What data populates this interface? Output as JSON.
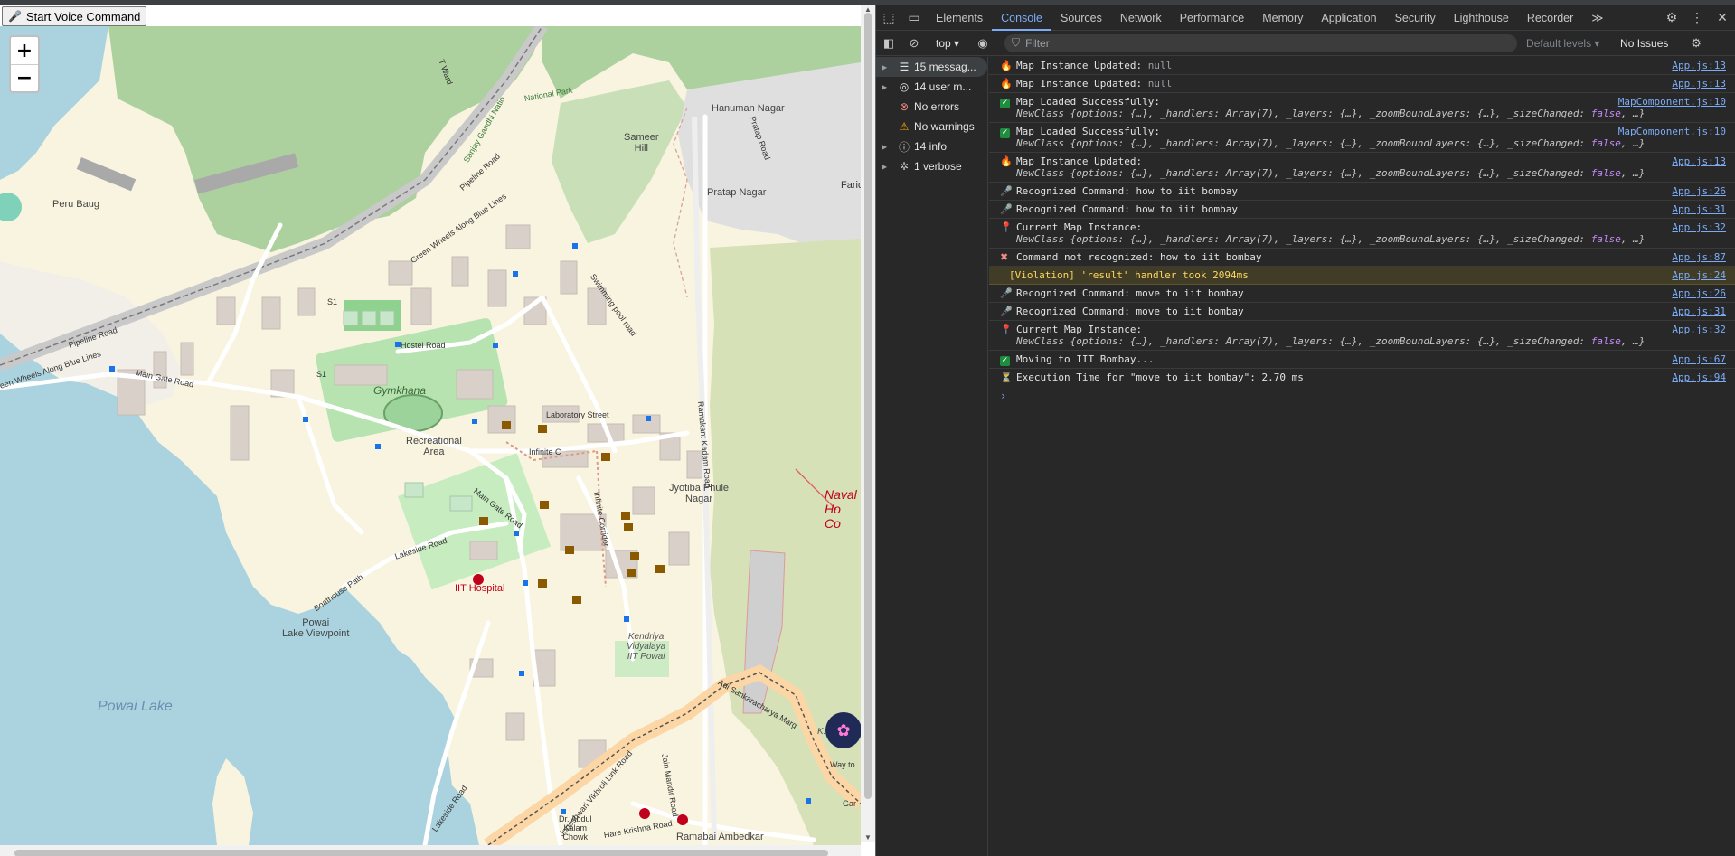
{
  "page": {
    "voice_button_label": "Start Voice Command",
    "voice_button_icon": "microphone-icon"
  },
  "map": {
    "zoom_in": "+",
    "zoom_out": "−",
    "labels": {
      "peru_baug": "Peru Baug",
      "hanuman_nagar": "Hanuman Nagar",
      "pratap_nagar": "Pratap Nagar",
      "sameer_hill": "Sameer\nHill",
      "gymkhana": "Gymkhana",
      "recreational_area": "Recreational\nArea",
      "laboratory_street": "Laboratory Street",
      "infinite_c": "Infinite C",
      "jyotiba_phule": "Jyotiba Phule\nNagar",
      "iit_hospital": "IIT Hospital",
      "powai_viewpoint": "Powai\nLake Viewpoint",
      "powai_lake": "Powai Lake",
      "kendriya": "Kendriya\nVidyalaya\nIIT Powai",
      "naval": "Naval\nHo\nCo",
      "hostel_road": "Hostel Road",
      "main_gate_road_1": "Main Gate Road",
      "main_gate_road_2": "Main Gate Road",
      "lakeside_road_1": "Lakeside Road",
      "lakeside_road_2": "Lakeside Road",
      "boathouse_path": "Boathouse Path",
      "pipeline_road_1": "Pipeline Road",
      "pipeline_road_2": "Pipeline Road",
      "green_wheels": "Green Wheels Along Blue Lines",
      "green_wheels_2": "een Wheels Along Blue Lines",
      "swimming_pool_road": "Swimming pool road",
      "ramakant_kadam_road": "Ramakant Kadam Road",
      "infinite_corridor": "Infinite Corridor",
      "adi_sankaracharya": "Adi Sankaracharya Marg",
      "jogeshwari_link": "Jogeshwari Vikhroli Link Road",
      "jain_mandir_road": "Jain Mandir Road",
      "hare_krishna_road": "Hare Krishna Road",
      "dr_abdul": "Dr. Abdul\nKalam\nChowk",
      "ramabai": "Ramabai Ambedkar",
      "t_ward": "T Ward",
      "sanjay_gandhi": "Sanjay Gandhi Natio",
      "national_park": "National Park",
      "pratap_road": "Pratap Road",
      "farid": "Farid",
      "kv_residen": "K.V. residen",
      "way_to": "Way to",
      "gar": "Gar",
      "s1_a": "S1",
      "s1_b": "S1"
    }
  },
  "devtools": {
    "tabs": [
      "Elements",
      "Console",
      "Sources",
      "Network",
      "Performance",
      "Memory",
      "Application",
      "Security",
      "Lighthouse",
      "Recorder"
    ],
    "active_tab": "Console",
    "more_tabs": "≫",
    "toolbar": {
      "context": "top",
      "filter_placeholder": "Filter",
      "levels": "Default levels",
      "issues": "No Issues"
    },
    "sidebar": [
      {
        "label": "15 messag...",
        "icon": "list-icon"
      },
      {
        "label": "14 user m...",
        "icon": "user-icon"
      },
      {
        "label": "No errors",
        "icon": "error-icon"
      },
      {
        "label": "No warnings",
        "icon": "warning-icon"
      },
      {
        "label": "14 info",
        "icon": "info-icon"
      },
      {
        "label": "1 verbose",
        "icon": "bug-icon"
      }
    ],
    "console": {
      "rows": [
        {
          "icon": "fire-icon",
          "text": "Map Instance Updated:",
          "extra": "null",
          "src": "App.js:13"
        },
        {
          "icon": "fire-icon",
          "text": "Map Instance Updated:",
          "extra": "null",
          "src": "App.js:13"
        },
        {
          "icon": "check-icon",
          "text": "Map Loaded Successfully:",
          "src": "MapComponent.js:10",
          "object": true
        },
        {
          "icon": "check-icon",
          "text": "Map Loaded Successfully:",
          "src": "MapComponent.js:10",
          "object": true
        },
        {
          "icon": "fire-icon",
          "text": "Map Instance Updated:",
          "src": "App.js:13",
          "object": true
        },
        {
          "icon": "mic-icon",
          "text": "Recognized Command: how to iit bombay",
          "src": "App.js:26"
        },
        {
          "icon": "mic-icon",
          "text": "Recognized Command: how to iit bombay",
          "src": "App.js:31"
        },
        {
          "icon": "pin-icon",
          "text": "Current Map Instance:",
          "src": "App.js:32",
          "object": true
        },
        {
          "icon": "x-icon",
          "text": "Command not recognized: how to iit bombay",
          "src": "App.js:87"
        },
        {
          "icon": "none",
          "text": "[Violation] 'result' handler took 2094ms",
          "src": "App.js:24",
          "violation": true
        },
        {
          "icon": "mic-icon",
          "text": "Recognized Command: move to iit bombay",
          "src": "App.js:26"
        },
        {
          "icon": "mic-icon",
          "text": "Recognized Command: move to iit bombay",
          "src": "App.js:31"
        },
        {
          "icon": "pin-icon",
          "text": "Current Map Instance:",
          "src": "App.js:32",
          "object": true
        },
        {
          "icon": "check-icon",
          "text": "Moving to IIT Bombay...",
          "src": "App.js:67"
        },
        {
          "icon": "hourglass-icon",
          "text": "Execution Time for \"move to iit bombay\": 2.70 ms",
          "src": "App.js:94"
        }
      ],
      "object_preview": {
        "class": "NewClass",
        "open": "{",
        "k1": "options",
        "v1": "{…}",
        "k2": "_handlers",
        "v2": "Array(7)",
        "k3": "_layers",
        "v3": "{…}",
        "k4": "_zoomBoundLayers",
        "v4": "{…}",
        "k5": "_sizeChanged",
        "v5": "false",
        "tail": ", …}"
      },
      "prompt": "›"
    }
  }
}
